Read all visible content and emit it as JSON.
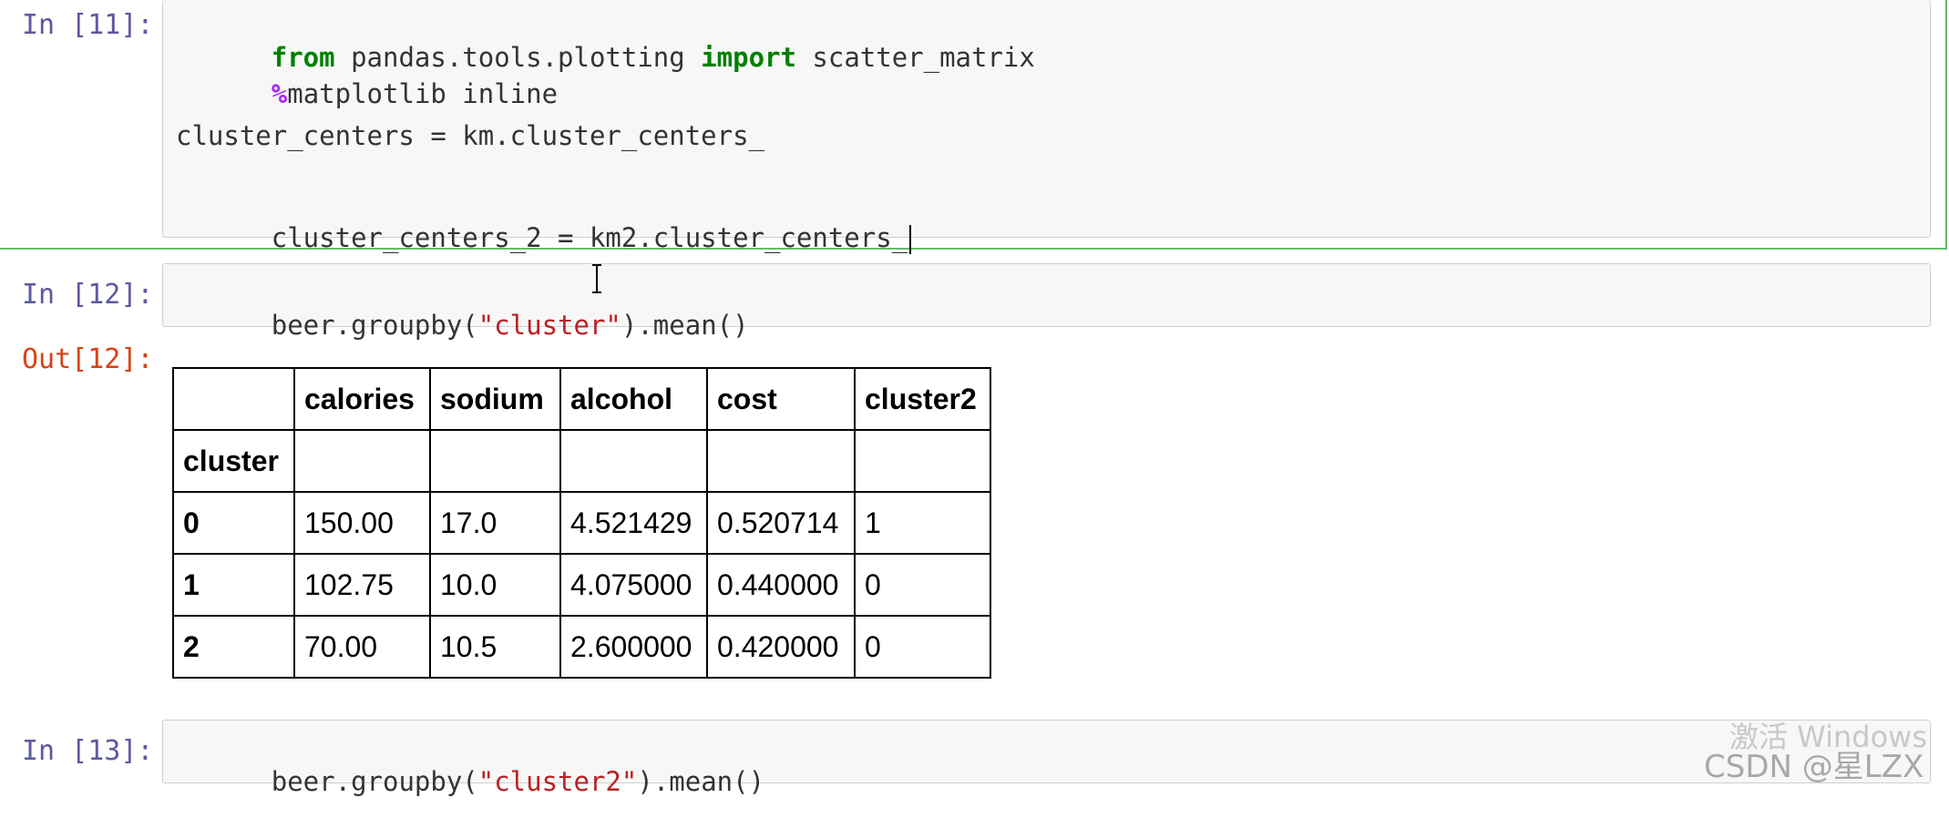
{
  "cells": [
    {
      "prompt": "In [11]:",
      "lines": [
        {
          "kw": "from",
          "mid": " pandas.tools.plotting ",
          "kw2": "import",
          "rest": " scatter_matrix"
        },
        {
          "magic": "%",
          "text": "matplotlib inline"
        },
        {
          "text": "cluster_centers = km.cluster_centers_"
        },
        {
          "text": "cluster_centers_2 = km2.cluster_centers_"
        }
      ]
    },
    {
      "prompt": "In [12]:",
      "code_pre": "beer.groupby(",
      "code_str": "\"cluster\"",
      "code_post": ").mean()"
    },
    {
      "out_prompt": "Out[12]:",
      "table": {
        "columns": [
          "",
          "calories",
          "sodium",
          "alcohol",
          "cost",
          "cluster2"
        ],
        "index_name": "cluster",
        "rows": [
          [
            "0",
            "150.00",
            "17.0",
            "4.521429",
            "0.520714",
            "1"
          ],
          [
            "1",
            "102.75",
            "10.0",
            "4.075000",
            "0.440000",
            "0"
          ],
          [
            "2",
            "70.00",
            "10.5",
            "2.600000",
            "0.420000",
            "0"
          ]
        ]
      }
    },
    {
      "prompt": "In [13]:",
      "code_pre": "beer.groupby(",
      "code_str": "\"cluster2\"",
      "code_post": ").mean()"
    }
  ],
  "watermark": {
    "line1": "激活 Windows",
    "line2": "CSDN @星LZX"
  }
}
